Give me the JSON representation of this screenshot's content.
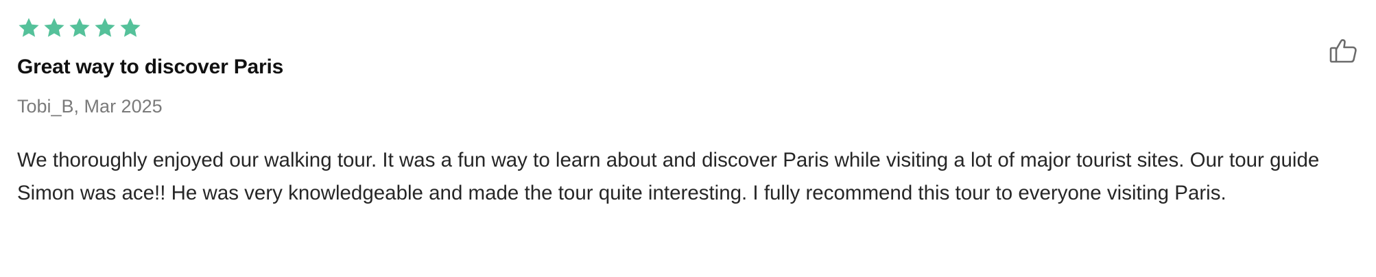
{
  "review": {
    "rating": 5,
    "max_rating": 5,
    "star_color": "#55c19a",
    "title": "Great way to discover Paris",
    "meta": "Tobi_B, Mar 2025",
    "body": "We thoroughly enjoyed our walking tour. It was a fun way to learn about and discover Paris while visiting a lot of major tourist sites. Our tour guide Simon was ace!! He was very knowledgeable and made the tour quite interesting. I fully recommend this tour to everyone visiting Paris."
  },
  "actions": {
    "like_icon": "thumbs-up-icon"
  }
}
